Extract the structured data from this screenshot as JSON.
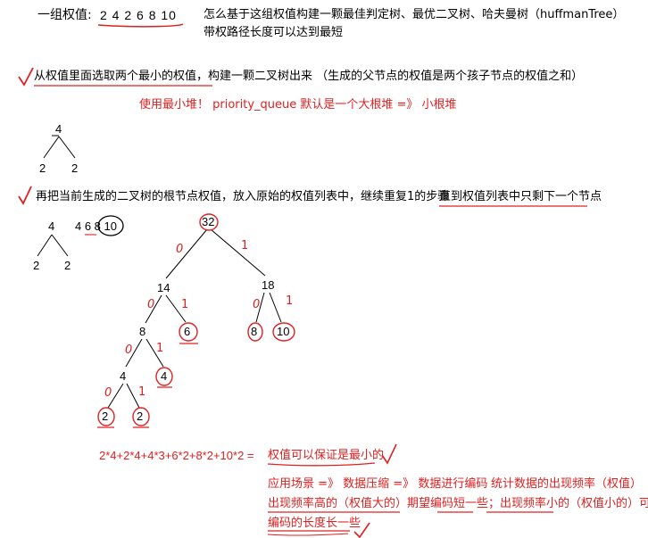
{
  "intro": {
    "label": "一组权值:",
    "values": "2 4 2 6 8 10",
    "question_line1": "怎么基于这组权值构建一颗最佳判定树、最优二叉树、哈夫曼树（huffmanTree）",
    "question_line2": "带权路径长度可以达到最短"
  },
  "step1": {
    "text": "从权值里面选取两个最小的权值，构建一颗二叉树出来 （生成的父节点的权值是两个孩子节点的权值之和）",
    "note": "使用最小堆！  priority_queue 默认是一个大根堆   =》 小根堆"
  },
  "tree_small": {
    "root": "4",
    "left": "2",
    "right": "2"
  },
  "step2": {
    "text": "再把当前生成的二叉树的根节点权值，放入原始的权值列表中，继续重复1的步骤",
    "underlined": "直到权值列表中只剩下一个节点"
  },
  "tree_small2": {
    "root": "4",
    "left": "2",
    "right": "2",
    "list": "4 6 8 10"
  },
  "huffman_tree": {
    "nodes": [
      "32",
      "14",
      "18",
      "8",
      "6",
      "8",
      "10",
      "4",
      "2",
      "2"
    ],
    "edge_labels": [
      "0",
      "1",
      "0",
      "1",
      "0",
      "1",
      "0",
      "1",
      "0",
      "1",
      "0",
      "1"
    ]
  },
  "formula": {
    "expr": "2*4+2*4+4*3+6*2+8*2+10*2 =",
    "conclusion": "权值可以保证是最小的"
  },
  "application": {
    "line1_a": "应用场景 =》 数据压缩 =》 数据进行编码",
    "line1_b": "统计数据的出现频率（权值）",
    "line2": "出现频率高的（权值大的）期望编码短一些；出现频率小的（权值小的）可以",
    "line3": "编码的长度长一些"
  },
  "colors": {
    "annotation": "#e02020",
    "text": "#000000"
  }
}
